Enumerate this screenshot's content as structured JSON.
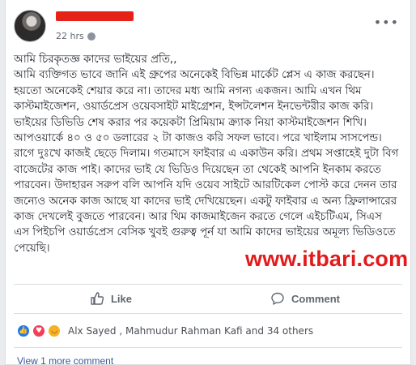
{
  "post": {
    "timestamp": "22 hrs",
    "text": "আমি চিরকৃতজ্ঞ কাদের ভাইয়ের প্রতি,,\nআমি ব্যক্তিগত ভাবে জানি এই গ্রুপের অনেকেই বিভিন্ন মার্কেট প্লেস এ কাজ করছেন। হয়তো অনেকেই শেয়ার করে না। তাদের মধ্য আমি নগন্য একজন। আমি এখন থিম কাস্টমাইজেশন, ওয়ার্ডপ্রেস ওয়েবসাইট মাইগ্রেশন, ইন্সটলেশন ইনভেন্টরীর কাজ করি। ভাইয়ের ডিভিডি শেষ করার পর কয়েকটা প্রিমিয়াম ক্র্যাক নিয়া কাস্টমাইজেশন শিখি। আপওয়ার্কে ৪০ ও ৫০ ডলারের ২ টা কাজও করি সফল ভাবে। পরে খাইলাম সাসপেন্ড। রাগে দুঃখে কাজই ছেড়ে দিলাম। গতমাসে ফাইবার এ একাউন করি। প্রথম সপ্তাহেই দুটা বিগ বাজেটের কাজ পাই। কাদের ভাই যে ভিডিও দিয়েছেন তা থেকেই আপনি ইনকাম করতে পারবেন। উদাহারন সরুপ বলি আপনি যদি ওয়েব সাইটে আরটিকেল পোস্ট করে দেনন তার জন্যেও অনেক কাজ আছে যা কাদের ভাই দেখিয়েছেন। একটু ফাইবার এ অন্য ফ্রিলান্সারের কাজ দেখলেই বুজতে পারবেন। আর থিম কাজমাইজেন করতে গেলে এইচটিএম, সিএস এস পিইচপি ওয়ার্ডপ্রেস বেসিক খুবই গুরুত্ব পূর্ন যা আমি কাদের ভাইয়ের অমূল্য ভিডিওতে পেয়েছি।",
    "watermark": "www.itbari.com"
  },
  "actions": {
    "like_label": "Like",
    "comment_label": "Comment"
  },
  "reactions": {
    "names_text": "Alx Sayed , Mahmudur Rahman Kafi and 34 others"
  },
  "comments": {
    "view_more_label": "View 1 more comment"
  },
  "colors": {
    "link": "#385898",
    "watermark": "#e31a1a",
    "redaction": "#e62117"
  }
}
